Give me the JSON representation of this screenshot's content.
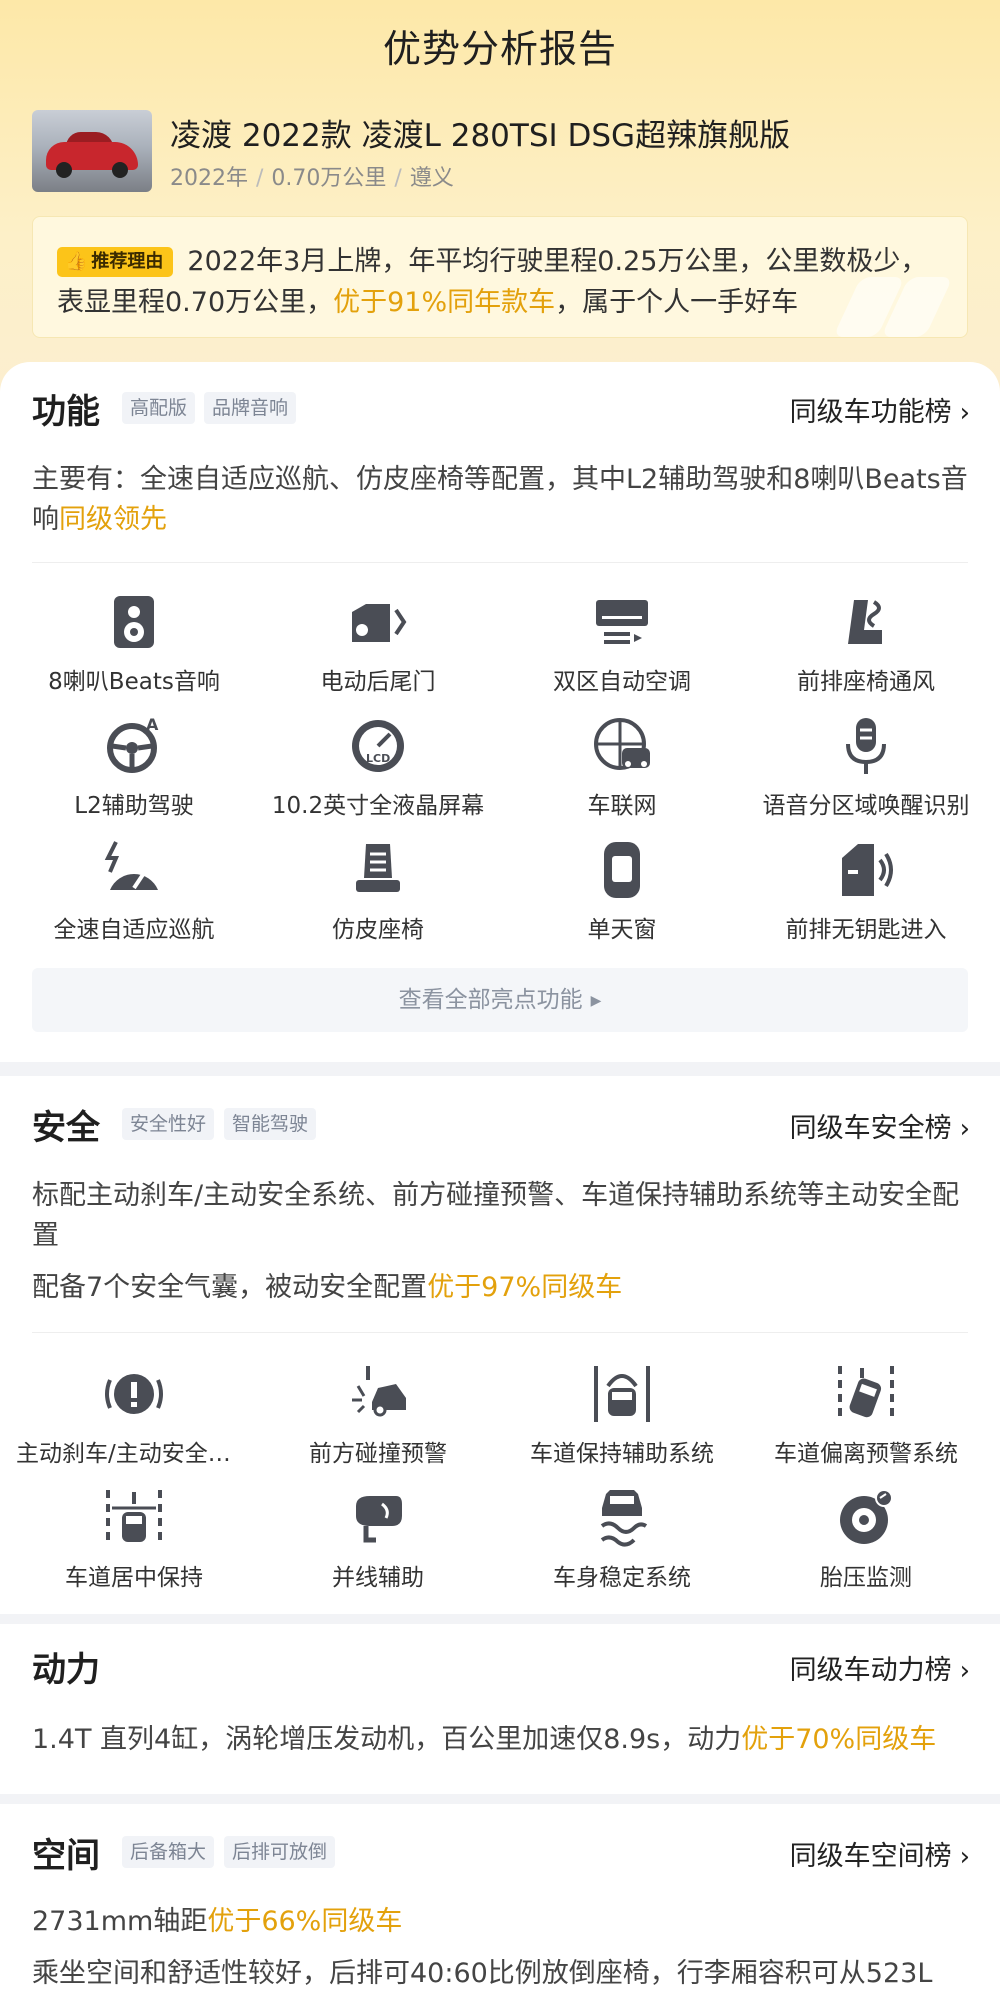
{
  "header": {
    "title": "优势分析报告"
  },
  "car": {
    "name": "凌渡 2022款 凌渡L 280TSI DSG超辣旗舰版",
    "year": "2022年",
    "mileage": "0.70万公里",
    "city": "遵义",
    "separator": "/"
  },
  "reason": {
    "badge": "推荐理由",
    "text_before": "2022年3月上牌，年平均行驶里程0.25万公里，公里数极少，表显里程0.70万公里，",
    "highlight": "优于91%同年款车",
    "text_after": "，属于个人一手好车"
  },
  "function_section": {
    "title": "功能",
    "tags": [
      "高配版",
      "品牌音响"
    ],
    "rank_link": "同级车功能榜",
    "desc_before": "主要有：全速自适应巡航、仿皮座椅等配置，其中L2辅助驾驶和8喇叭Beats音响",
    "desc_highlight": "同级领先",
    "features": [
      {
        "label": "8喇叭Beats音响",
        "icon": "speaker-icon"
      },
      {
        "label": "电动后尾门",
        "icon": "power-tailgate-icon"
      },
      {
        "label": "双区自动空调",
        "icon": "air-conditioner-icon"
      },
      {
        "label": "前排座椅通风",
        "icon": "seat-ventilation-icon"
      },
      {
        "label": "L2辅助驾驶",
        "icon": "steering-wheel-icon"
      },
      {
        "label": "10.2英寸全液晶屏幕",
        "icon": "lcd-gauge-icon"
      },
      {
        "label": "车联网",
        "icon": "connected-car-icon"
      },
      {
        "label": "语音分区域唤醒识别",
        "icon": "microphone-icon"
      },
      {
        "label": "全速自适应巡航",
        "icon": "cruise-gauge-icon"
      },
      {
        "label": "仿皮座椅",
        "icon": "leather-seat-icon"
      },
      {
        "label": "单天窗",
        "icon": "sunroof-icon"
      },
      {
        "label": "前排无钥匙进入",
        "icon": "keyless-door-icon"
      }
    ],
    "view_all": "查看全部亮点功能"
  },
  "safety_section": {
    "title": "安全",
    "tags": [
      "安全性好",
      "智能驾驶"
    ],
    "rank_link": "同级车安全榜",
    "desc1": "标配主动刹车/主动安全系统、前方碰撞预警、车道保持辅助系统等主动安全配置",
    "desc2_before": "配备7个安全气囊，被动安全配置",
    "desc2_highlight": "优于97%同级车",
    "features": [
      {
        "label": "主动刹车/主动安全系统",
        "icon": "brake-warning-icon"
      },
      {
        "label": "前方碰撞预警",
        "icon": "collision-warning-icon"
      },
      {
        "label": "车道保持辅助系统",
        "icon": "lane-keep-icon"
      },
      {
        "label": "车道偏离预警系统",
        "icon": "lane-departure-icon"
      },
      {
        "label": "车道居中保持",
        "icon": "lane-center-icon"
      },
      {
        "label": "并线辅助",
        "icon": "side-mirror-icon"
      },
      {
        "label": "车身稳定系统",
        "icon": "stability-control-icon"
      },
      {
        "label": "胎压监测",
        "icon": "tire-pressure-icon"
      }
    ]
  },
  "power_section": {
    "title": "动力",
    "rank_link": "同级车动力榜",
    "desc_before": "1.4T 直列4缸，涡轮增压发动机，百公里加速仅8.9s，动力",
    "desc_highlight": "优于70%同级车"
  },
  "space_section": {
    "title": "空间",
    "tags": [
      "后备箱大",
      "后排可放倒"
    ],
    "rank_link": "同级车空间榜",
    "desc1_before": "2731mm轴距",
    "desc1_highlight": "优于66%同级车",
    "desc2": "乘坐空间和舒适性较好，后排可40:60比例放倒座椅，行李厢容积可从523L"
  },
  "colors": {
    "accent": "#e3a10c",
    "badge": "#fcc419",
    "icon": "#4a4d55"
  }
}
